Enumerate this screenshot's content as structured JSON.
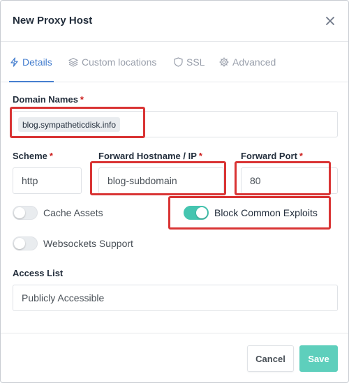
{
  "modal": {
    "title": "New Proxy Host",
    "close_icon": "close-icon"
  },
  "tabs": [
    {
      "label": "Details",
      "icon": "lightning-icon",
      "active": true
    },
    {
      "label": "Custom locations",
      "icon": "layers-icon",
      "active": false
    },
    {
      "label": "SSL",
      "icon": "shield-icon",
      "active": false
    },
    {
      "label": "Advanced",
      "icon": "gear-icon",
      "active": false
    }
  ],
  "form": {
    "domain_names": {
      "label": "Domain Names",
      "required": "*",
      "chips": [
        "blog.sympatheticdisk.info"
      ]
    },
    "scheme": {
      "label": "Scheme",
      "required": "*",
      "value": "http"
    },
    "forward_hostname": {
      "label": "Forward Hostname / IP",
      "required": "*",
      "value": "blog-subdomain"
    },
    "forward_port": {
      "label": "Forward Port",
      "required": "*",
      "value": "80"
    },
    "toggles": {
      "cache_assets": {
        "label": "Cache Assets",
        "enabled": false
      },
      "block_common_exploits": {
        "label": "Block Common Exploits",
        "enabled": true
      },
      "websockets_support": {
        "label": "Websockets Support",
        "enabled": false
      }
    },
    "access_list": {
      "label": "Access List",
      "value": "Publicly Accessible"
    }
  },
  "footer": {
    "cancel_label": "Cancel",
    "save_label": "Save"
  },
  "colors": {
    "accent": "#467fcf",
    "toggle_on": "#45c5b0",
    "save_button": "#5ecfbc",
    "required": "#cd201f",
    "highlight": "#d93434"
  }
}
